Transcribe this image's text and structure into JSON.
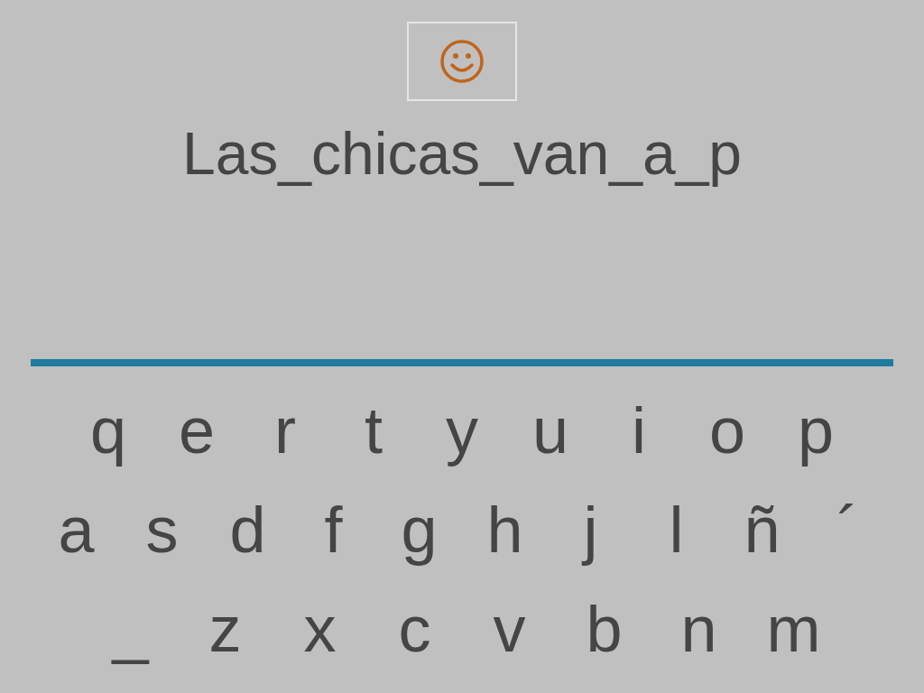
{
  "answer": "Las_chicas_van_a_p",
  "keyboard": {
    "rows": [
      [
        "q",
        "e",
        "r",
        "t",
        "y",
        "u",
        "i",
        "o",
        "p"
      ],
      [
        "a",
        "s",
        "d",
        "f",
        "g",
        "h",
        "j",
        "l",
        "ñ",
        "´"
      ],
      [
        "_",
        "z",
        "x",
        "c",
        "v",
        "b",
        "n",
        "m"
      ]
    ]
  }
}
